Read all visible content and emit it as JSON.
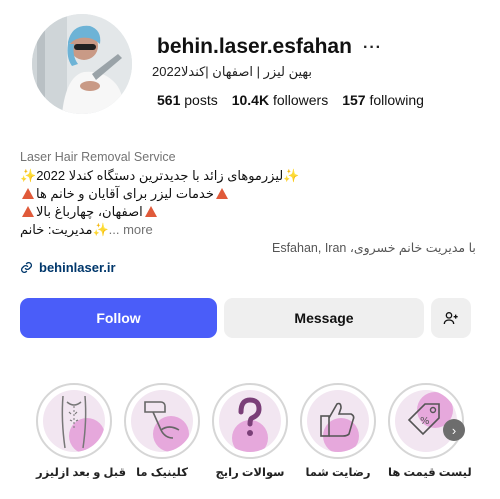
{
  "profile": {
    "username": "behin.laser.esfahan",
    "more_label": "···",
    "full_name": "بهین لیزر | اصفهان |کندلا2022",
    "stats": {
      "posts": "561",
      "posts_label": "posts",
      "followers": "10.4K",
      "followers_label": "followers",
      "following": "157",
      "following_label": "following"
    },
    "category": "Laser Hair Removal Service",
    "bio": {
      "line1": "لیزرموهای زائد با جدیدترین دستگاه کندلا 2022",
      "line2": "خدمات لیزر برای آقایان و خانم ها",
      "line3": "اصفهان، چهارباغ بالا",
      "line4": "مدیریت: خانم",
      "more": "... more"
    },
    "location_note": "با مدیریت خانم خسروی، Esfahan, Iran",
    "link": "behinlaser.ir"
  },
  "actions": {
    "follow": "Follow",
    "message": "Message"
  },
  "highlights": [
    {
      "label": "قبل و بعد ازلیزر",
      "icon": "body-icon"
    },
    {
      "label": "کلینیک ما",
      "icon": "laser-device-icon"
    },
    {
      "label": "سوالات رایج",
      "icon": "question-icon"
    },
    {
      "label": "رضایت شما",
      "icon": "thumbs-up-icon"
    },
    {
      "label": "لیست قیمت ها",
      "icon": "price-tag-icon"
    }
  ],
  "colors": {
    "follow_button": "#4a5df9",
    "secondary_button": "#efefef",
    "link": "#00376b",
    "highlight_accent": "#e6a8dc"
  }
}
